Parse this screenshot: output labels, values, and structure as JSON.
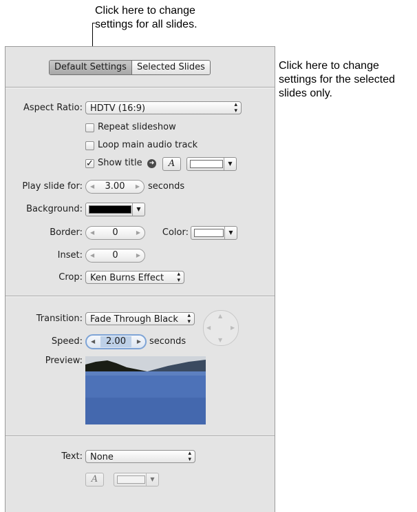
{
  "callouts": {
    "top": [
      "Click here to change",
      "settings for all slides."
    ],
    "right": [
      "Click here to change",
      "settings for the selected",
      "slides only."
    ]
  },
  "tabs": {
    "default": "Default Settings",
    "selected": "Selected Slides"
  },
  "aspect": {
    "label": "Aspect Ratio:",
    "value": "HDTV (16:9)"
  },
  "checkboxes": {
    "repeat": {
      "label": "Repeat slideshow",
      "checked": false
    },
    "loop": {
      "label": "Loop main audio track",
      "checked": false
    },
    "show_title": {
      "label": "Show title",
      "checked": true,
      "mark": "✓"
    }
  },
  "font_glyph": "A",
  "play": {
    "label": "Play slide for:",
    "value": "3.00",
    "unit": "seconds"
  },
  "background": {
    "label": "Background:",
    "color": "#000000"
  },
  "border": {
    "label": "Border:",
    "value": "0",
    "color_label": "Color:",
    "color": "#ffffff"
  },
  "inset": {
    "label": "Inset:",
    "value": "0"
  },
  "crop": {
    "label": "Crop:",
    "value": "Ken Burns Effect"
  },
  "transition": {
    "label": "Transition:",
    "value": "Fade Through Black"
  },
  "speed": {
    "label": "Speed:",
    "value": "2.00",
    "unit": "seconds"
  },
  "preview": {
    "label": "Preview:"
  },
  "text": {
    "label": "Text:",
    "value": "None"
  },
  "title_color": "#ffffff",
  "text_color": "#ffffff",
  "icons": {
    "popup": "up-down-arrows",
    "dropdown": "down-triangle",
    "stepper": "left-right-arrows",
    "show_title_arrow": "circle-arrow-right",
    "direction_pad": "four-way-arrows"
  }
}
